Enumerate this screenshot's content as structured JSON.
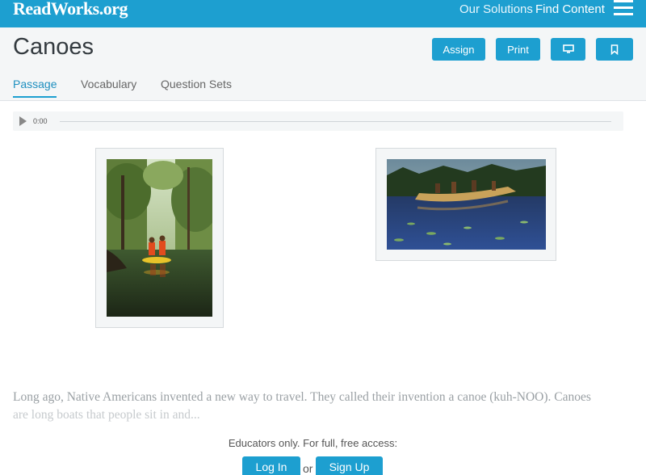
{
  "brand": {
    "logo": "ReadWorks.org",
    "accent": "#1d9fd0"
  },
  "nav": {
    "our_solutions": "Our Solutions",
    "find_content": "Find Content",
    "menu_icon": "hamburger-icon"
  },
  "header": {
    "title": "Canoes",
    "assign_label": "Assign",
    "print_label": "Print",
    "present_icon": "monitor-icon",
    "bookmark_icon": "bookmark-icon"
  },
  "tabs": [
    {
      "label": "Passage",
      "active": true
    },
    {
      "label": "Vocabulary",
      "active": false
    },
    {
      "label": "Question Sets",
      "active": false
    }
  ],
  "audio": {
    "time": "0:00",
    "progress": 0
  },
  "passage": {
    "line1": "Long ago, Native Americans invented a new way to travel. They called their invention a canoe (kuh-NOO). Canoes",
    "line2": "are long boats that people sit in and..."
  },
  "gate": {
    "message": "Educators only. For full, free access:",
    "login_label": "Log In",
    "or_label": "or",
    "signup_label": "Sign Up"
  }
}
